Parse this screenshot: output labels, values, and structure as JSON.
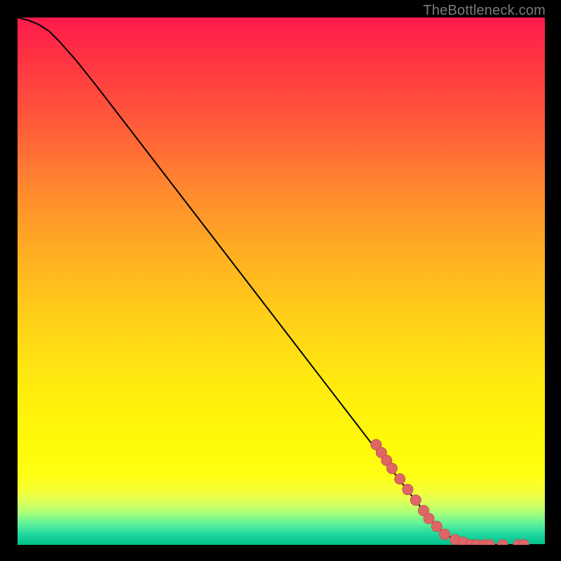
{
  "watermark": "TheBottleneck.com",
  "colors": {
    "background": "#000000",
    "curve_stroke": "#000000",
    "marker_fill": "#e06666",
    "marker_stroke": "#c15555",
    "watermark": "#7a7a7a"
  },
  "chart_data": {
    "type": "line",
    "title": "",
    "xlabel": "",
    "ylabel": "",
    "xlim": [
      0,
      100
    ],
    "ylim": [
      0,
      100
    ],
    "grid": false,
    "legend": false,
    "series": [
      {
        "name": "curve",
        "x": [
          0,
          2,
          4,
          6,
          8,
          11,
          15,
          20,
          25,
          30,
          35,
          40,
          45,
          50,
          55,
          60,
          65,
          70,
          75,
          78,
          80,
          82,
          85,
          88,
          92,
          96,
          100
        ],
        "y": [
          100,
          99.5,
          98.7,
          97.4,
          95.4,
          92,
          87,
          80.5,
          74,
          67.5,
          61,
          54.5,
          48,
          41.5,
          35,
          28.5,
          22,
          15.5,
          9,
          5.2,
          3,
          1.5,
          0.5,
          0,
          0,
          0,
          0
        ]
      }
    ],
    "markers": [
      {
        "x": 68,
        "y": 19
      },
      {
        "x": 69,
        "y": 17.5
      },
      {
        "x": 70,
        "y": 16
      },
      {
        "x": 71,
        "y": 14.5
      },
      {
        "x": 72.5,
        "y": 12.5
      },
      {
        "x": 74,
        "y": 10.5
      },
      {
        "x": 75.5,
        "y": 8.5
      },
      {
        "x": 77,
        "y": 6.5
      },
      {
        "x": 78,
        "y": 5
      },
      {
        "x": 79.5,
        "y": 3.5
      },
      {
        "x": 81,
        "y": 2
      },
      {
        "x": 83,
        "y": 1
      },
      {
        "x": 84.5,
        "y": 0.5
      },
      {
        "x": 86,
        "y": 0
      },
      {
        "x": 87,
        "y": 0
      },
      {
        "x": 88.5,
        "y": 0
      },
      {
        "x": 89.5,
        "y": 0
      },
      {
        "x": 92,
        "y": 0
      },
      {
        "x": 95,
        "y": 0
      },
      {
        "x": 96,
        "y": 0
      }
    ]
  }
}
